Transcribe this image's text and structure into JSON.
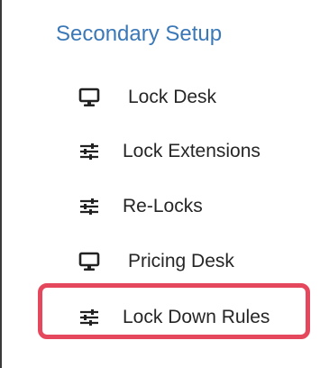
{
  "section": {
    "title": "Secondary Setup"
  },
  "menu": {
    "items": [
      {
        "label": "Lock Desk",
        "icon": "monitor-icon"
      },
      {
        "label": "Lock Extensions",
        "icon": "sliders-icon"
      },
      {
        "label": "Re-Locks",
        "icon": "sliders-icon"
      },
      {
        "label": "Pricing Desk",
        "icon": "monitor-icon"
      },
      {
        "label": "Lock Down Rules",
        "icon": "sliders-icon"
      }
    ]
  },
  "colors": {
    "title": "#3a78b8",
    "text": "#262626",
    "highlight": "#e5485c"
  },
  "highlighted_item": "Lock Down Rules"
}
